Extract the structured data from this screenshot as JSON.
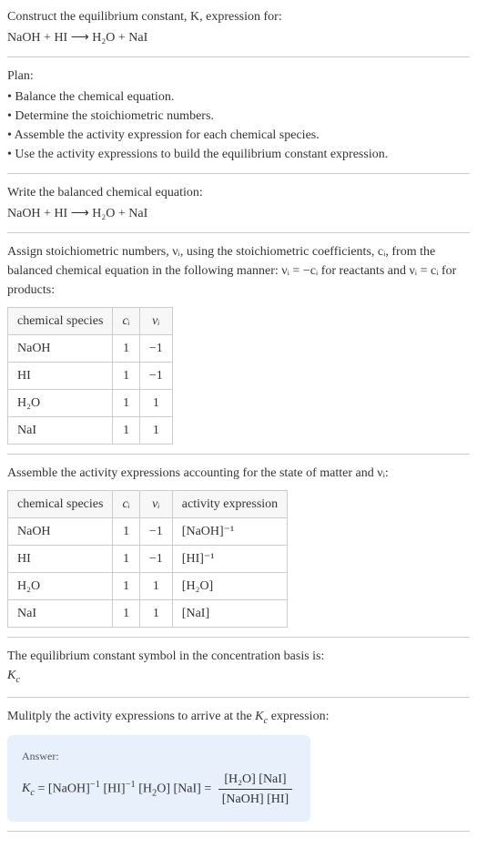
{
  "intro": {
    "prompt": "Construct the equilibrium constant, K, expression for:",
    "equation": "NaOH + HI ⟶ H₂O + NaI"
  },
  "plan": {
    "title": "Plan:",
    "items": [
      "• Balance the chemical equation.",
      "• Determine the stoichiometric numbers.",
      "• Assemble the activity expression for each chemical species.",
      "• Use the activity expressions to build the equilibrium constant expression."
    ]
  },
  "balance": {
    "title": "Write the balanced chemical equation:",
    "equation": "NaOH + HI ⟶ H₂O + NaI"
  },
  "stoich": {
    "intro_a": "Assign stoichiometric numbers, νᵢ, using the stoichiometric coefficients, cᵢ, from the balanced chemical equation in the following manner: νᵢ = −cᵢ for reactants and νᵢ = cᵢ for products:",
    "headers": {
      "species": "chemical species",
      "ci": "cᵢ",
      "vi": "νᵢ"
    },
    "rows": [
      {
        "species": "NaOH",
        "ci": "1",
        "vi": "−1"
      },
      {
        "species": "HI",
        "ci": "1",
        "vi": "−1"
      },
      {
        "species": "H₂O",
        "ci": "1",
        "vi": "1"
      },
      {
        "species": "NaI",
        "ci": "1",
        "vi": "1"
      }
    ]
  },
  "activity": {
    "title": "Assemble the activity expressions accounting for the state of matter and νᵢ:",
    "headers": {
      "species": "chemical species",
      "ci": "cᵢ",
      "vi": "νᵢ",
      "act": "activity expression"
    },
    "rows": [
      {
        "species": "NaOH",
        "ci": "1",
        "vi": "−1",
        "act": "[NaOH]⁻¹"
      },
      {
        "species": "HI",
        "ci": "1",
        "vi": "−1",
        "act": "[HI]⁻¹"
      },
      {
        "species": "H₂O",
        "ci": "1",
        "vi": "1",
        "act": "[H₂O]"
      },
      {
        "species": "NaI",
        "ci": "1",
        "vi": "1",
        "act": "[NaI]"
      }
    ]
  },
  "symbol": {
    "title": "The equilibrium constant symbol in the concentration basis is:",
    "value": "K_c"
  },
  "multiply": {
    "title": "Mulitply the activity expressions to arrive at the K_c expression:"
  },
  "answer": {
    "label": "Answer:",
    "lhs": "K_c = [NaOH]⁻¹ [HI]⁻¹ [H₂O] [NaI] = ",
    "numerator": "[H₂O] [NaI]",
    "denominator": "[NaOH] [HI]"
  },
  "chart_data": [
    {
      "type": "table",
      "title": "Stoichiometric numbers",
      "columns": [
        "chemical species",
        "cᵢ",
        "νᵢ"
      ],
      "rows": [
        [
          "NaOH",
          1,
          -1
        ],
        [
          "HI",
          1,
          -1
        ],
        [
          "H₂O",
          1,
          1
        ],
        [
          "NaI",
          1,
          1
        ]
      ]
    },
    {
      "type": "table",
      "title": "Activity expressions",
      "columns": [
        "chemical species",
        "cᵢ",
        "νᵢ",
        "activity expression"
      ],
      "rows": [
        [
          "NaOH",
          1,
          -1,
          "[NaOH]⁻¹"
        ],
        [
          "HI",
          1,
          -1,
          "[HI]⁻¹"
        ],
        [
          "H₂O",
          1,
          1,
          "[H₂O]"
        ],
        [
          "NaI",
          1,
          1,
          "[NaI]"
        ]
      ]
    }
  ]
}
